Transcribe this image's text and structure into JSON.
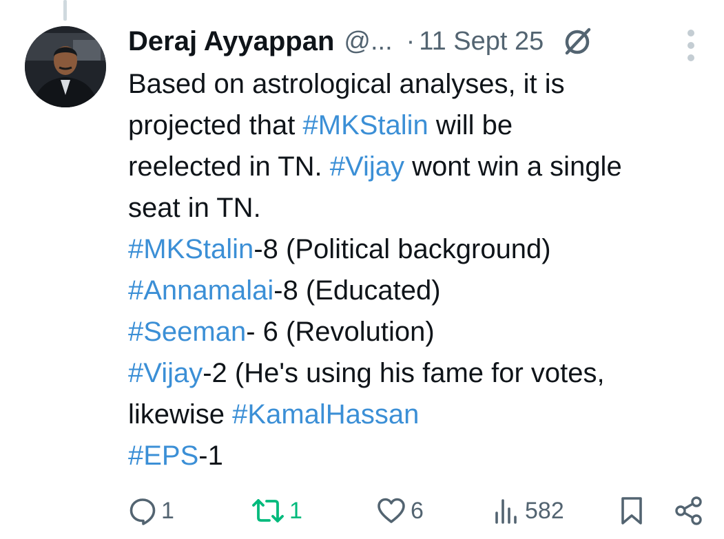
{
  "tweet": {
    "author_name": "Deraj Ayyappan",
    "handle": "@...",
    "separator": "·",
    "date": "11 Sept 25",
    "body": [
      [
        {
          "t": "Based on astrological analyses, it is"
        }
      ],
      [
        {
          "t": "projected that "
        },
        {
          "t": "#MKStalin",
          "tag": true
        },
        {
          "t": " will be"
        }
      ],
      [
        {
          "t": "reelected in TN.  "
        },
        {
          "t": "#Vijay",
          "tag": true
        },
        {
          "t": " wont win a single"
        }
      ],
      [
        {
          "t": "seat in TN."
        }
      ],
      [
        {
          "t": "#MKStalin",
          "tag": true
        },
        {
          "t": "-8 (Political background)"
        }
      ],
      [
        {
          "t": "#Annamalai",
          "tag": true
        },
        {
          "t": "-8 (Educated)"
        }
      ],
      [
        {
          "t": "#Seeman",
          "tag": true
        },
        {
          "t": "- 6 (Revolution)"
        }
      ],
      [
        {
          "t": "#Vijay",
          "tag": true
        },
        {
          "t": "-2 (He's using his fame for votes,"
        }
      ],
      [
        {
          "t": "likewise "
        },
        {
          "t": "#KamalHassan",
          "tag": true
        }
      ],
      [
        {
          "t": "#EPS",
          "tag": true
        },
        {
          "t": "-1"
        }
      ]
    ]
  },
  "actions": {
    "reply": {
      "icon": "reply-icon",
      "count": "1"
    },
    "repost": {
      "icon": "repost-icon",
      "count": "1"
    },
    "like": {
      "icon": "heart-icon",
      "count": "6"
    },
    "views": {
      "icon": "views-icon",
      "count": "582"
    },
    "bookmark": {
      "icon": "bookmark-icon"
    },
    "share": {
      "icon": "share-icon"
    }
  },
  "colors": {
    "text": "#0f1419",
    "secondary": "#536471",
    "hashtag": "#3b8fd6",
    "repost": "#00ba7c"
  }
}
